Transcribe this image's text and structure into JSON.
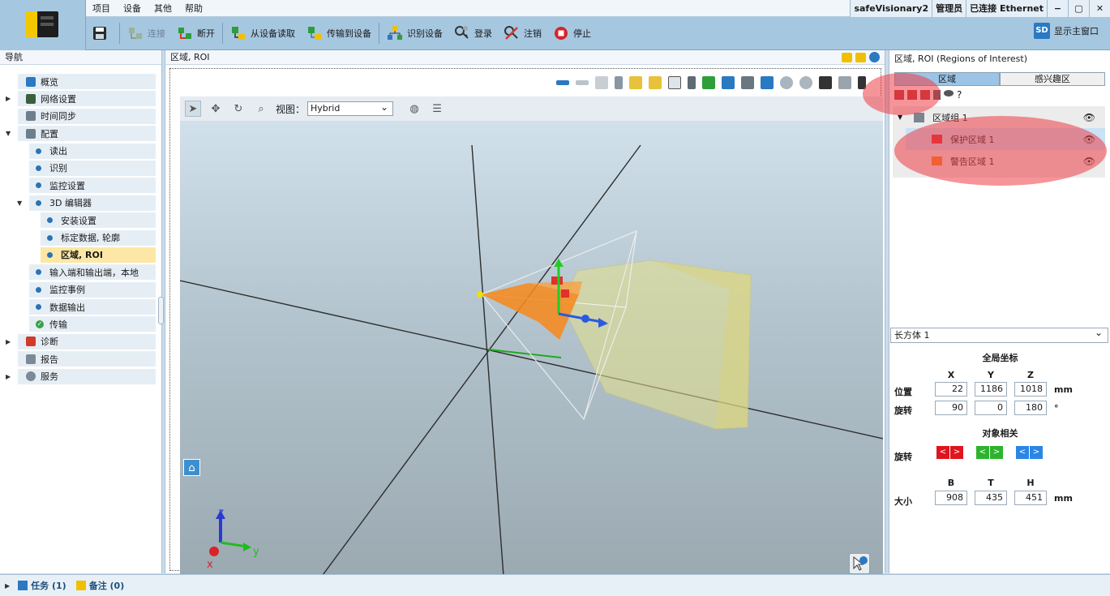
{
  "menu": [
    "项目",
    "设备",
    "其他",
    "帮助"
  ],
  "status": {
    "device": "safeVisionary2",
    "role": "管理员",
    "connection": "已连接 Ethernet"
  },
  "window_buttons": [
    "−",
    "▢",
    "✕"
  ],
  "toolbar": {
    "connect": "连接",
    "disconnect": "断开",
    "read_device": "从设备读取",
    "transfer": "传输到设备",
    "identify": "识别设备",
    "login": "登录",
    "logout": "注销",
    "stop": "停止",
    "show_main": "显示主窗口",
    "sd_label": "SD"
  },
  "nav": {
    "title": "导航",
    "items": [
      {
        "label": "概览"
      },
      {
        "label": "网络设置"
      },
      {
        "label": "时间同步"
      },
      {
        "label": "配置"
      },
      {
        "label": "读出"
      },
      {
        "label": "识别"
      },
      {
        "label": "监控设置"
      },
      {
        "label": "3D 编辑器"
      },
      {
        "label": "安装设置"
      },
      {
        "label": "标定数据, 轮廓"
      },
      {
        "label": "区域, ROI"
      },
      {
        "label": "输入端和输出端，本地"
      },
      {
        "label": "监控事例"
      },
      {
        "label": "数据输出"
      },
      {
        "label": "传输"
      },
      {
        "label": "诊断"
      },
      {
        "label": "报告"
      },
      {
        "label": "服务"
      }
    ]
  },
  "center": {
    "title": "区域, ROI",
    "view_label": "视图：",
    "view_value": "Hybrid",
    "axes": {
      "x": "x",
      "y": "y",
      "z": "z"
    }
  },
  "right": {
    "title": "区域, ROI (Regions of Interest)",
    "tabs": [
      "区域",
      "感兴趣区"
    ],
    "tree": {
      "group": "区域组 1",
      "protect": "保护区域 1",
      "warn": "警告区域 1"
    },
    "shape": "长方体 1",
    "global_title": "全局坐标",
    "xyz": [
      "X",
      "Y",
      "Z"
    ],
    "pos_label": "位置",
    "rot_label": "旋转",
    "pos": [
      "22",
      "1186",
      "1018"
    ],
    "rot": [
      "90",
      "0",
      "180"
    ],
    "mm": "mm",
    "deg": "°",
    "rel_title": "对象相关",
    "rel_rot": "旋转",
    "size_cols": [
      "B",
      "T",
      "H"
    ],
    "size_label": "大小",
    "size": [
      "908",
      "435",
      "451"
    ],
    "arrows": [
      "<",
      ">"
    ]
  },
  "bottom": {
    "tasks": "任务 (1)",
    "notes": "备注 (0)"
  },
  "colors": {
    "toolbar": "#a6c7e0",
    "accent": "#2b79c2",
    "highlight": "#ec3c46",
    "zone_orange": "#f58a1f",
    "zone_yellow": "#e6e08a"
  }
}
